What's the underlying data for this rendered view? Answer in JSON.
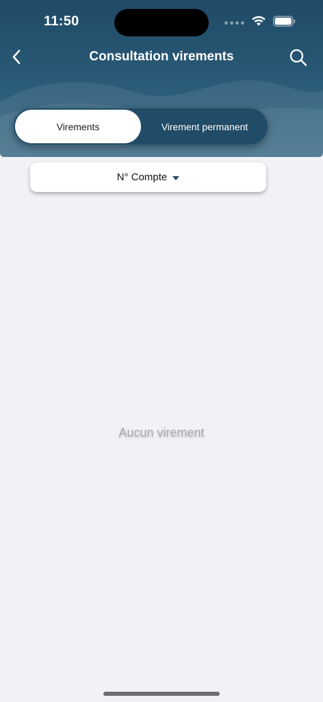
{
  "status_bar": {
    "time": "11:50"
  },
  "nav": {
    "title": "Consultation virements",
    "back_icon": "chevron-left-icon",
    "search_icon": "search-icon"
  },
  "tabs": [
    {
      "label": "Virements",
      "selected": true
    },
    {
      "label": "Virement permanent",
      "selected": false
    }
  ],
  "account_filter": {
    "label": "N° Compte"
  },
  "empty_state": {
    "message": "Aucun virement"
  },
  "colors": {
    "header_bg": "#1f4a66",
    "page_bg": "#f2f1f6",
    "accent": "#214c68"
  }
}
